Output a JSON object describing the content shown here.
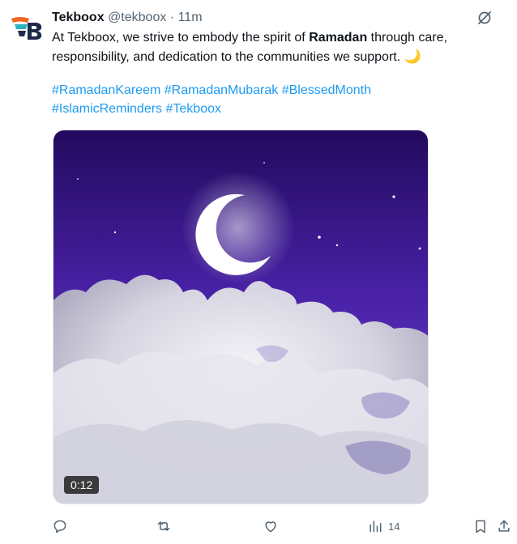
{
  "tweet": {
    "author_name": "Tekboox",
    "handle": "@tekboox",
    "separator": "·",
    "time": "11m",
    "text_before": "At Tekboox, we strive to embody the spirit of ",
    "text_bold": "Ramadan",
    "text_after": " through care, responsibility, and dedication to the communities we support.",
    "emoji": "🌙",
    "hashtags": [
      "#RamadanKareem",
      "#RamadanMubarak",
      "#BlessedMonth",
      "#IslamicReminders",
      "#Tekboox"
    ],
    "video_duration": "0:12"
  },
  "actions": {
    "reply_icon": "reply-icon",
    "repost_icon": "repost-icon",
    "like_icon": "like-icon",
    "views_icon": "views-icon",
    "views_count": "14",
    "bookmark_icon": "bookmark-icon",
    "share_icon": "share-icon"
  },
  "colors": {
    "link": "#1d9bf0",
    "muted": "#536471",
    "sky_top": "#2a0d6e",
    "sky_bottom": "#6a3fd0",
    "logo_orange": "#f26522",
    "logo_navy": "#1b2a4a"
  }
}
